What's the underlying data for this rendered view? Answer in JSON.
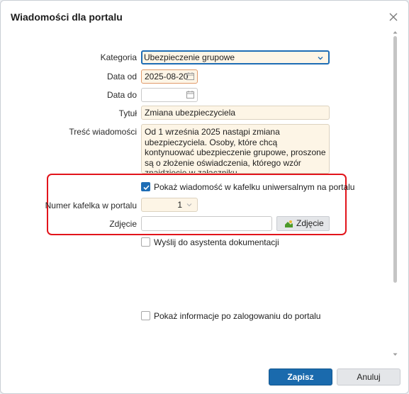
{
  "dialog": {
    "title": "Wiadomości dla portalu",
    "close_icon": "close-icon"
  },
  "form": {
    "kategoria_label": "Kategoria",
    "kategoria_value": "Ubezpieczenie grupowe",
    "data_od_label": "Data od",
    "data_od_value": "2025-08-20",
    "data_do_label": "Data do",
    "data_do_value": "",
    "tytul_label": "Tytuł",
    "tytul_value": "Zmiana ubezpieczyciela",
    "tresc_label": "Treść wiadomości",
    "tresc_value": "Od 1 września 2025 nastąpi zmiana ubezpieczyciela. Osoby, które chcą kontynuować ubezpieczenie grupowe, proszone są o złożenie oświadczenia, którego wzór znajdziecie w załączniku.",
    "pokaz_kafelek_label": "Pokaż wiadomość w kafelku uniwersalnym na portalu",
    "pokaz_kafelek_checked": true,
    "numer_kafelka_label": "Numer kafelka w portalu",
    "numer_kafelka_value": "1",
    "zdjecie_label": "Zdjęcie",
    "zdjecie_value": "",
    "zdjecie_button_label": "Zdjęcie",
    "wyslij_label": "Wyślij do asystenta dokumentacji",
    "wyslij_checked": false,
    "pokaz_info_label": "Pokaż informacje po zalogowaniu do portalu",
    "pokaz_info_checked": false
  },
  "footer": {
    "save_label": "Zapisz",
    "cancel_label": "Anuluj"
  },
  "colors": {
    "accent": "#1a6aad",
    "highlight": "#e2141b",
    "field_bg": "#fdf5e6"
  }
}
